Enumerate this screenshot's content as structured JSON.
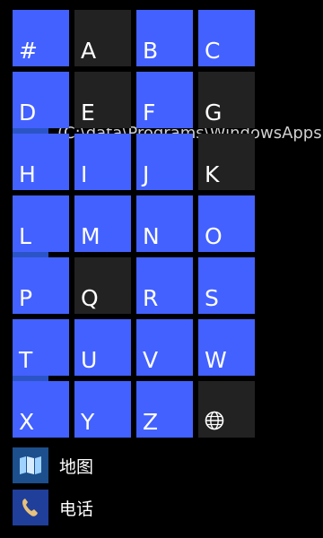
{
  "theme": {
    "accent": "#4361ff",
    "dim_tile": "#222222",
    "background": "#000000"
  },
  "background_list": {
    "fragments": [
      "(C:\\data\\Programs\\WindowsApps"
    ],
    "apps": [
      {
        "label": "地图",
        "icon": "map-icon"
      },
      {
        "label": "电话",
        "icon": "phone-icon"
      }
    ]
  },
  "jump_grid": {
    "tiles": [
      {
        "label": "#",
        "active": true
      },
      {
        "label": "A",
        "active": false
      },
      {
        "label": "B",
        "active": true
      },
      {
        "label": "C",
        "active": true
      },
      {
        "label": "D",
        "active": true
      },
      {
        "label": "E",
        "active": false
      },
      {
        "label": "F",
        "active": true
      },
      {
        "label": "G",
        "active": false
      },
      {
        "label": "H",
        "active": true
      },
      {
        "label": "I",
        "active": true
      },
      {
        "label": "J",
        "active": true
      },
      {
        "label": "K",
        "active": false
      },
      {
        "label": "L",
        "active": true
      },
      {
        "label": "M",
        "active": true
      },
      {
        "label": "N",
        "active": true
      },
      {
        "label": "O",
        "active": true
      },
      {
        "label": "P",
        "active": true
      },
      {
        "label": "Q",
        "active": false
      },
      {
        "label": "R",
        "active": true
      },
      {
        "label": "S",
        "active": true
      },
      {
        "label": "T",
        "active": true
      },
      {
        "label": "U",
        "active": true
      },
      {
        "label": "V",
        "active": true
      },
      {
        "label": "W",
        "active": true
      },
      {
        "label": "X",
        "active": true
      },
      {
        "label": "Y",
        "active": true
      },
      {
        "label": "Z",
        "active": true
      },
      {
        "label": "",
        "icon": "globe-icon",
        "active": false
      }
    ]
  }
}
